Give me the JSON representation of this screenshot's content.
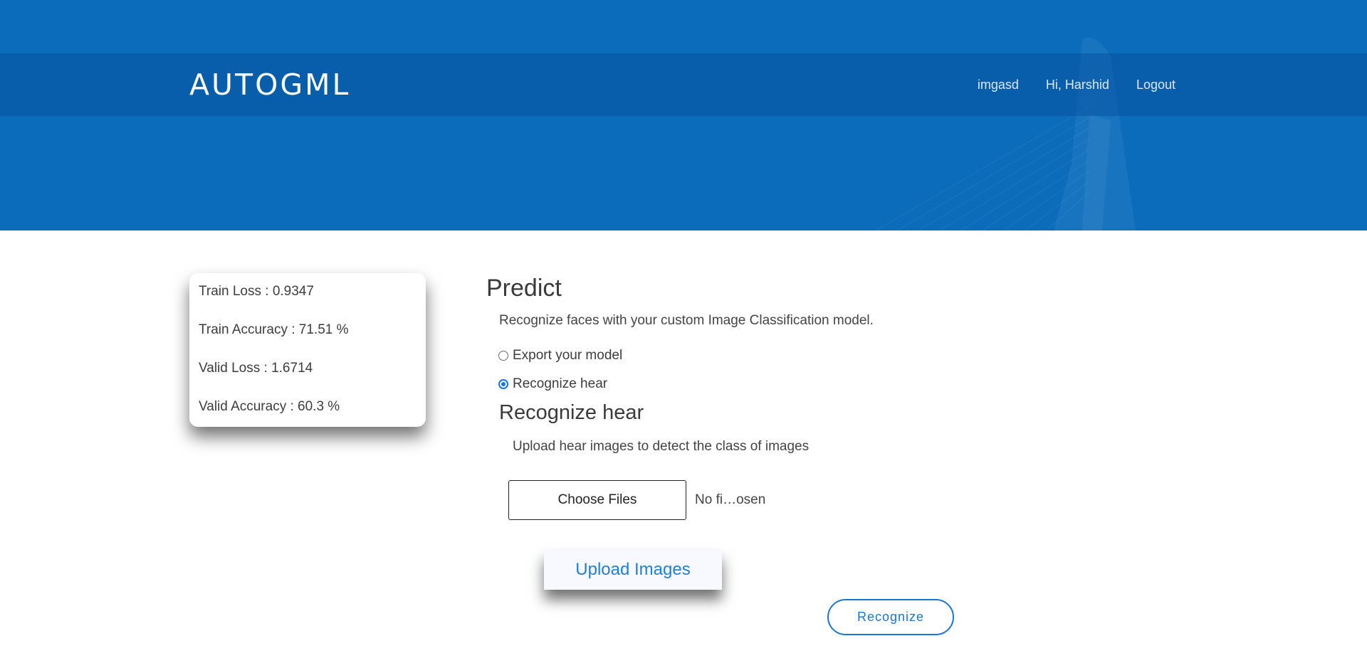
{
  "header": {
    "brand": "AUTOGML",
    "nav": [
      "imgasd",
      "Hi, Harshid",
      "Logout"
    ]
  },
  "metrics": [
    {
      "label": "Train Loss : 0.9347"
    },
    {
      "label": "Train Accuracy : 71.51 %"
    },
    {
      "label": "Valid Loss : 1.6714"
    },
    {
      "label": "Valid Accuracy : 60.3 %"
    }
  ],
  "predict": {
    "title": "Predict",
    "description": "Recognize faces with your custom Image Classification model.",
    "options": [
      {
        "label": "Export your model",
        "checked": false
      },
      {
        "label": "Recognize hear",
        "checked": true
      }
    ]
  },
  "recognize": {
    "title": "Recognize hear",
    "description": "Upload hear images to detect the class of images",
    "file_button": "Choose Files",
    "file_status": "No fi…osen",
    "upload_button": "Upload Images",
    "recognize_button": "Recognize"
  },
  "colors": {
    "hero": "#0b6cbb",
    "accent": "#1976d2"
  }
}
